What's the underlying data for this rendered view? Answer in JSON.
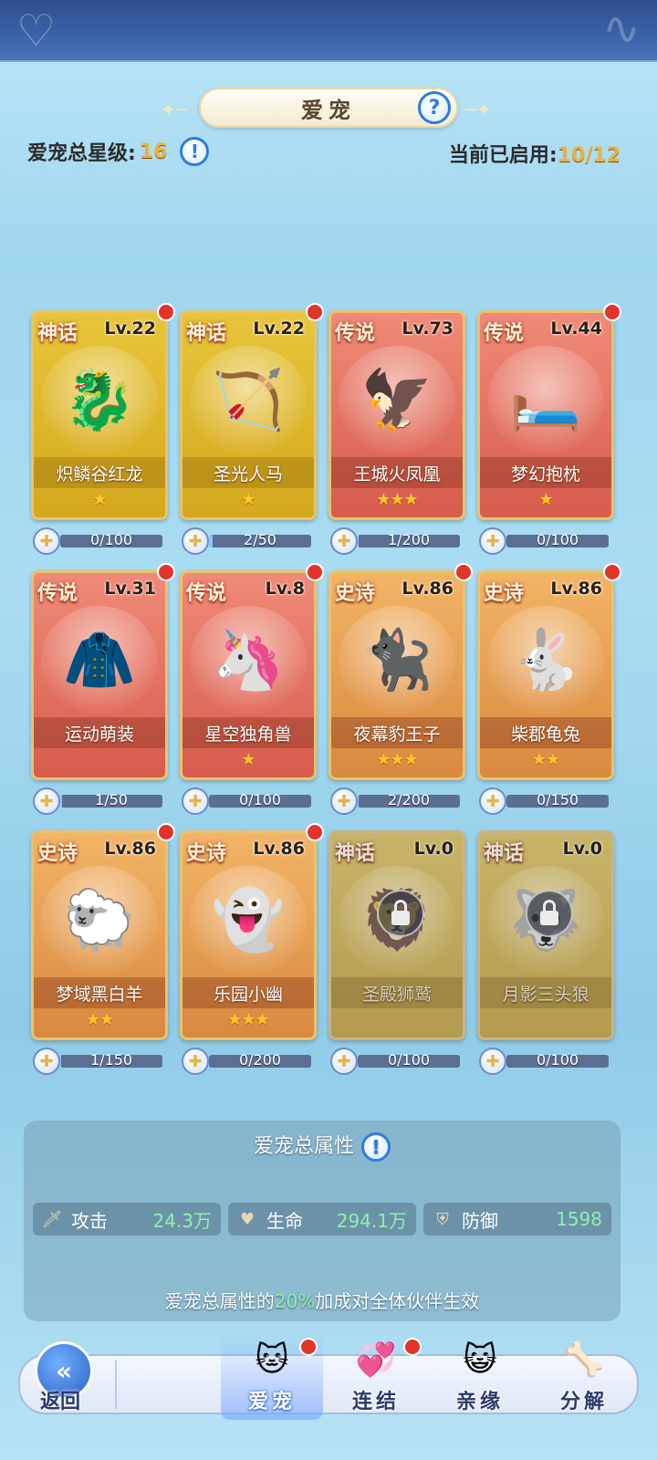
{
  "header": {
    "title": "爱宠",
    "total_star_label": "爱宠总星级:",
    "total_star_value": "16",
    "enabled_label": "当前已启用:",
    "enabled_value": "10/12"
  },
  "pets": [
    {
      "rarity": "神话",
      "level": "Lv.22",
      "name": "炽鳞谷红龙",
      "stars": "★",
      "progress_text": "0/100",
      "progress": 0.0,
      "art_icon": "🐉",
      "red_dot": true,
      "locked": false,
      "tier": "myth"
    },
    {
      "rarity": "神话",
      "level": "Lv.22",
      "name": "圣光人马",
      "stars": "★",
      "progress_text": "2/50",
      "progress": 0.04,
      "art_icon": "🏹",
      "red_dot": true,
      "locked": false,
      "tier": "myth"
    },
    {
      "rarity": "传说",
      "level": "Lv.73",
      "name": "王城火凤凰",
      "stars": "★★★",
      "progress_text": "1/200",
      "progress": 0.005,
      "art_icon": "🦅",
      "red_dot": false,
      "locked": false,
      "tier": "legend"
    },
    {
      "rarity": "传说",
      "level": "Lv.44",
      "name": "梦幻抱枕",
      "stars": "★",
      "progress_text": "0/100",
      "progress": 0.0,
      "art_icon": "🛏️",
      "red_dot": true,
      "locked": false,
      "tier": "legend"
    },
    {
      "rarity": "传说",
      "level": "Lv.31",
      "name": "运动萌装",
      "stars": "",
      "progress_text": "1/50",
      "progress": 0.02,
      "art_icon": "🧥",
      "red_dot": true,
      "locked": false,
      "tier": "legend"
    },
    {
      "rarity": "传说",
      "level": "Lv.8",
      "name": "星空独角兽",
      "stars": "★",
      "progress_text": "0/100",
      "progress": 0.0,
      "art_icon": "🦄",
      "red_dot": true,
      "locked": false,
      "tier": "legend"
    },
    {
      "rarity": "史诗",
      "level": "Lv.86",
      "name": "夜幕豹王子",
      "stars": "★★★",
      "progress_text": "2/200",
      "progress": 0.01,
      "art_icon": "🐈‍⬛",
      "red_dot": true,
      "locked": false,
      "tier": "epic"
    },
    {
      "rarity": "史诗",
      "level": "Lv.86",
      "name": "柴郡龟兔",
      "stars": "★★",
      "progress_text": "0/150",
      "progress": 0.0,
      "art_icon": "🐇",
      "red_dot": true,
      "locked": false,
      "tier": "epic"
    },
    {
      "rarity": "史诗",
      "level": "Lv.86",
      "name": "梦域黑白羊",
      "stars": "★★",
      "progress_text": "1/150",
      "progress": 0.007,
      "art_icon": "🐑",
      "red_dot": true,
      "locked": false,
      "tier": "epic"
    },
    {
      "rarity": "史诗",
      "level": "Lv.86",
      "name": "乐园小幽",
      "stars": "★★★",
      "progress_text": "0/200",
      "progress": 0.0,
      "art_icon": "👻",
      "red_dot": true,
      "locked": false,
      "tier": "epic"
    },
    {
      "rarity": "神话",
      "level": "Lv.0",
      "name": "圣殿狮鹫",
      "stars": "",
      "progress_text": "0/100",
      "progress": 0.0,
      "art_icon": "🦁",
      "red_dot": false,
      "locked": true,
      "tier": "myth"
    },
    {
      "rarity": "神话",
      "level": "Lv.0",
      "name": "月影三头狼",
      "stars": "",
      "progress_text": "0/100",
      "progress": 0.0,
      "art_icon": "🐺",
      "red_dot": false,
      "locked": true,
      "tier": "myth"
    }
  ],
  "attributes": {
    "title": "爱宠总属性",
    "items": [
      {
        "label": "攻击",
        "value": "24.3万",
        "icon": "sword-icon"
      },
      {
        "label": "生命",
        "value": "294.1万",
        "icon": "heart-icon"
      },
      {
        "label": "防御",
        "value": "1598",
        "icon": "shield-icon"
      }
    ],
    "note_prefix": "爱宠总属性的",
    "note_highlight": "20%",
    "note_suffix": "加成对全体伙伴生效"
  },
  "bottom_nav": {
    "back_label": "返回",
    "tabs": [
      {
        "label": "爱宠",
        "icon": "cat-icon",
        "active": true,
        "red_dot": true
      },
      {
        "label": "连结",
        "icon": "heart-link-icon",
        "active": false,
        "red_dot": true
      },
      {
        "label": "亲缘",
        "icon": "paw-cat-icon",
        "active": false,
        "red_dot": false
      },
      {
        "label": "分解",
        "icon": "bone-icon",
        "active": false,
        "red_dot": false
      }
    ]
  },
  "colors": {
    "accent_gold": "#e9b341",
    "stat_green": "#8ff0b0",
    "notify_red": "#e2342a"
  }
}
